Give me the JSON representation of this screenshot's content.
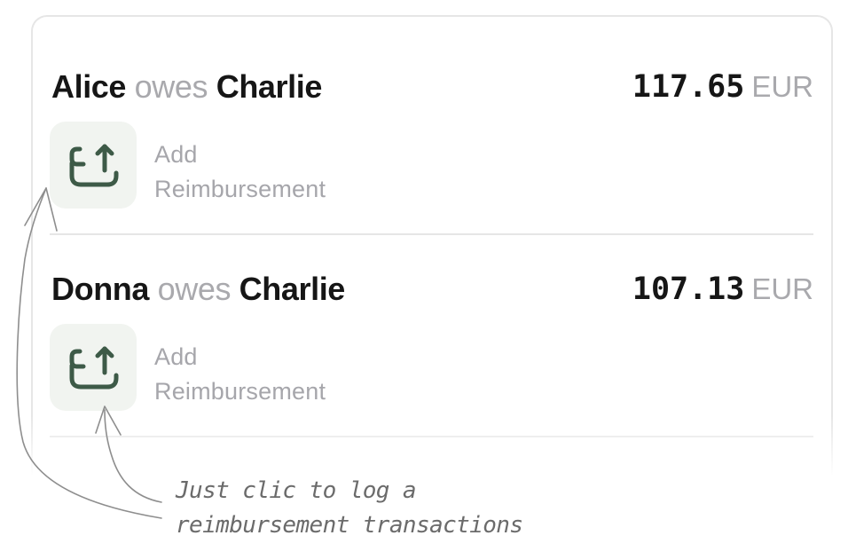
{
  "debts": [
    {
      "debtor": "Alice",
      "verb": "owes",
      "creditor": "Charlie",
      "amount": "117.65",
      "currency": "EUR",
      "action": {
        "line1": "Add",
        "line2": "Reimbursement",
        "icon": "reimbursement-upload-icon"
      }
    },
    {
      "debtor": "Donna",
      "verb": "owes",
      "creditor": "Charlie",
      "amount": "107.13",
      "currency": "EUR",
      "action": {
        "line1": "Add",
        "line2": "Reimbursement",
        "icon": "reimbursement-upload-icon"
      }
    }
  ],
  "annotation": {
    "line1": "Just clic to log a",
    "line2": "reimbursement transactions"
  },
  "colors": {
    "text_primary": "#161616",
    "text_muted": "#a9a9ad",
    "button_bg": "#f1f4f0",
    "icon": "#3d5a47",
    "divider": "#e6e6e6",
    "annotation": "#6b6b6b"
  }
}
